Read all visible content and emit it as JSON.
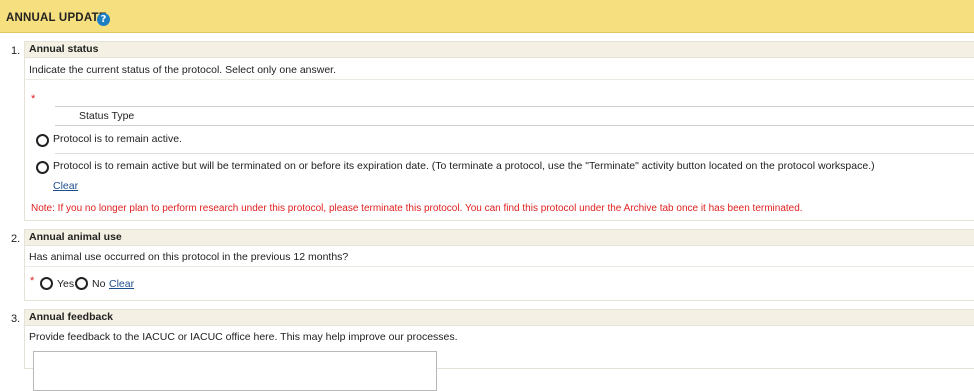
{
  "header": {
    "title": "ANNUAL UPDATE",
    "help_glyph": "?"
  },
  "sections": [
    {
      "number": "1.",
      "title": "Annual status",
      "description": "Indicate the current status of the protocol. Select only one answer.",
      "required_mark": "*",
      "table_header": "Status Type",
      "options": [
        "Protocol is to remain active.",
        "Protocol is to remain active but will be terminated on or before its expiration date. (To terminate a protocol, use the \"Terminate\" activity button located on the protocol workspace.)"
      ],
      "clear_label": "Clear",
      "note": "Note: If you no longer plan to perform research under this protocol, please terminate this protocol. You can find this protocol under the Archive tab once it has been terminated."
    },
    {
      "number": "2.",
      "title": "Annual animal use",
      "description": "Has animal use occurred on this protocol in the previous 12 months?",
      "required_mark": "*",
      "options": [
        "Yes",
        "No"
      ],
      "clear_label": "Clear"
    },
    {
      "number": "3.",
      "title": "Annual feedback",
      "description": "Provide feedback to the IACUC or IACUC office here. This may help improve our processes.",
      "textarea_value": ""
    }
  ]
}
